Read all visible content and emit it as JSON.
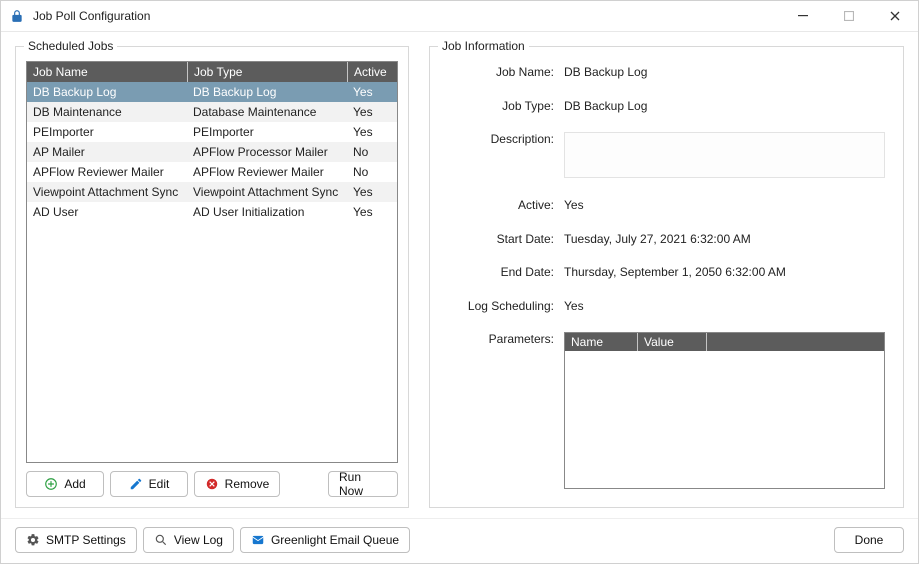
{
  "window": {
    "title": "Job Poll Configuration"
  },
  "scheduled_jobs": {
    "legend": "Scheduled Jobs",
    "columns": {
      "name": "Job Name",
      "type": "Job Type",
      "active": "Active"
    },
    "rows": [
      {
        "name": "DB Backup Log",
        "type": "DB Backup Log",
        "active": "Yes",
        "selected": true
      },
      {
        "name": "DB Maintenance",
        "type": "Database Maintenance",
        "active": "Yes"
      },
      {
        "name": "PEImporter",
        "type": "PEImporter",
        "active": "Yes"
      },
      {
        "name": "AP Mailer",
        "type": "APFlow Processor Mailer",
        "active": "No"
      },
      {
        "name": "APFlow Reviewer Mailer",
        "type": "APFlow Reviewer Mailer",
        "active": "No"
      },
      {
        "name": "Viewpoint Attachment Sync",
        "type": "Viewpoint Attachment Sync",
        "active": "Yes"
      },
      {
        "name": "AD User",
        "type": "AD User Initialization",
        "active": "Yes"
      }
    ]
  },
  "buttons": {
    "add": "Add",
    "edit": "Edit",
    "remove": "Remove",
    "run_now": "Run Now",
    "smtp_settings": "SMTP Settings",
    "view_log": "View Log",
    "greenlight_queue": "Greenlight Email Queue",
    "done": "Done"
  },
  "job_info": {
    "legend": "Job Information",
    "labels": {
      "job_name": "Job Name:",
      "job_type": "Job Type:",
      "description": "Description:",
      "active": "Active:",
      "start_date": "Start Date:",
      "end_date": "End Date:",
      "log_scheduling": "Log Scheduling:",
      "parameters": "Parameters:"
    },
    "values": {
      "job_name": "DB Backup Log",
      "job_type": "DB Backup Log",
      "description": "",
      "active": "Yes",
      "start_date": "Tuesday, July 27, 2021 6:32:00 AM",
      "end_date": "Thursday, September 1, 2050 6:32:00 AM",
      "log_scheduling": "Yes"
    },
    "parameters": {
      "columns": {
        "name": "Name",
        "value": "Value"
      },
      "rows": []
    }
  }
}
